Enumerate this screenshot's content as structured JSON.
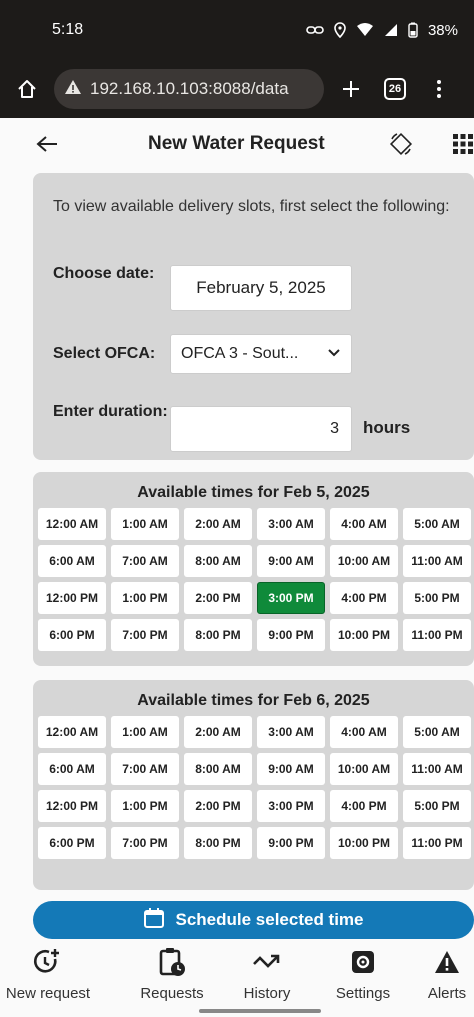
{
  "status_bar": {
    "time": "5:18",
    "battery": "38%"
  },
  "browser": {
    "url": "192.168.10.103:8088/data",
    "tab_count": "26"
  },
  "header": {
    "title": "New Water Request"
  },
  "form": {
    "intro": "To view available delivery slots, first select the following:",
    "date_label": "Choose date:",
    "date_value": "February 5, 2025",
    "ofca_label": "Select OFCA:",
    "ofca_value": "OFCA 3 - Sout...",
    "duration_label": "Enter duration:",
    "duration_value": "3",
    "duration_unit": "hours"
  },
  "time_panels": [
    {
      "title": "Available times for Feb 5, 2025",
      "slots": [
        "12:00 AM",
        "1:00 AM",
        "2:00 AM",
        "3:00 AM",
        "4:00 AM",
        "5:00 AM",
        "6:00 AM",
        "7:00 AM",
        "8:00 AM",
        "9:00 AM",
        "10:00 AM",
        "11:00 AM",
        "12:00 PM",
        "1:00 PM",
        "2:00 PM",
        "3:00 PM",
        "4:00 PM",
        "5:00 PM",
        "6:00 PM",
        "7:00 PM",
        "8:00 PM",
        "9:00 PM",
        "10:00 PM",
        "11:00 PM"
      ],
      "selected": "3:00 PM"
    },
    {
      "title": "Available times for Feb 6, 2025",
      "slots": [
        "12:00 AM",
        "1:00 AM",
        "2:00 AM",
        "3:00 AM",
        "4:00 AM",
        "5:00 AM",
        "6:00 AM",
        "7:00 AM",
        "8:00 AM",
        "9:00 AM",
        "10:00 AM",
        "11:00 AM",
        "12:00 PM",
        "1:00 PM",
        "2:00 PM",
        "3:00 PM",
        "4:00 PM",
        "5:00 PM",
        "6:00 PM",
        "7:00 PM",
        "8:00 PM",
        "9:00 PM",
        "10:00 PM",
        "11:00 PM"
      ],
      "selected": ""
    }
  ],
  "schedule_button": {
    "label": "Schedule selected time"
  },
  "nav": [
    {
      "label": "New request",
      "icon": "clock-plus-icon"
    },
    {
      "label": "Requests",
      "icon": "clipboard-clock-icon"
    },
    {
      "label": "History",
      "icon": "trend-icon"
    },
    {
      "label": "Settings",
      "icon": "settings-icon"
    },
    {
      "label": "Alerts",
      "icon": "alert-icon"
    }
  ],
  "colors": {
    "accent": "#1479b7",
    "selected": "#0f8a3a",
    "panel": "#d6d6d6"
  }
}
